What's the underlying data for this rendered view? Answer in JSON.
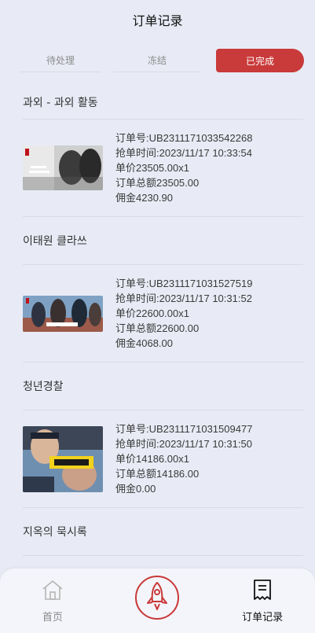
{
  "header": {
    "title": "订单记录"
  },
  "tabs": [
    {
      "label": "待处理"
    },
    {
      "label": "冻结"
    },
    {
      "label": "已完成"
    }
  ],
  "colors": {
    "accent": "#c93a3a",
    "background": "#e8ebf5"
  },
  "sections": [
    {
      "title": "과외 - 과외 활동",
      "order": {
        "order_no": "订单号:UB2311171033542268",
        "time": "抢单时间:2023/11/17 10:33:54",
        "unit_price": "单价23505.00x1",
        "total": "订单总额23505.00",
        "commission": "佣金4230.90"
      }
    },
    {
      "title": "이태원 클라쓰",
      "order": {
        "order_no": "订单号:UB2311171031527519",
        "time": "抢单时间:2023/11/17 10:31:52",
        "unit_price": "单价22600.00x1",
        "total": "订单总额22600.00",
        "commission": "佣金4068.00"
      }
    },
    {
      "title": "청년경찰",
      "order": {
        "order_no": "订单号:UB2311171031509477",
        "time": "抢单时间:2023/11/17 10:31:50",
        "unit_price": "单价14186.00x1",
        "total": "订单总额14186.00",
        "commission": "佣金0.00"
      }
    },
    {
      "title": "지옥의 묵시록"
    }
  ],
  "footer": {
    "home_label": "首页",
    "orders_label": "订单记录",
    "home_icon": "home-icon",
    "center_icon": "rocket-icon",
    "orders_icon": "document-icon"
  }
}
